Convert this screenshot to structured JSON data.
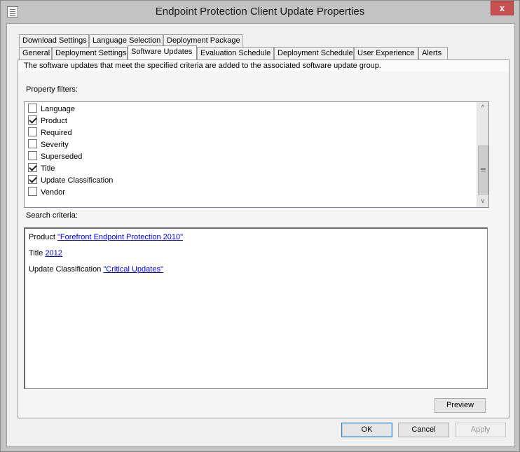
{
  "window": {
    "title": "Endpoint Protection Client Update Properties",
    "close_glyph": "x"
  },
  "tabs": {
    "row1": [
      "Download Settings",
      "Language Selection",
      "Deployment Package"
    ],
    "row2": [
      "General",
      "Deployment Settings",
      "Software Updates",
      "Evaluation Schedule",
      "Deployment Schedule",
      "User Experience",
      "Alerts"
    ],
    "active": "Software Updates"
  },
  "panel": {
    "description": "The software updates that meet the specified criteria are added to the associated software update group.",
    "property_filters_label": "Property filters:",
    "filters": [
      {
        "label": "Language",
        "checked": false
      },
      {
        "label": "Product",
        "checked": true
      },
      {
        "label": "Required",
        "checked": false
      },
      {
        "label": "Severity",
        "checked": false
      },
      {
        "label": "Superseded",
        "checked": false
      },
      {
        "label": "Title",
        "checked": true
      },
      {
        "label": "Update Classification",
        "checked": true
      },
      {
        "label": "Vendor",
        "checked": false
      }
    ],
    "search_criteria_label": "Search criteria:",
    "criteria": [
      {
        "name": "Product",
        "value": "\"Forefront Endpoint Protection 2010\""
      },
      {
        "name": "Title",
        "value": "2012"
      },
      {
        "name": "Update Classification",
        "value": "\"Critical Updates\""
      }
    ],
    "preview_label": "Preview"
  },
  "buttons": {
    "ok": "OK",
    "cancel": "Cancel",
    "apply": "Apply"
  },
  "scrollbar": {
    "up_glyph": "^",
    "down_glyph": "v"
  }
}
